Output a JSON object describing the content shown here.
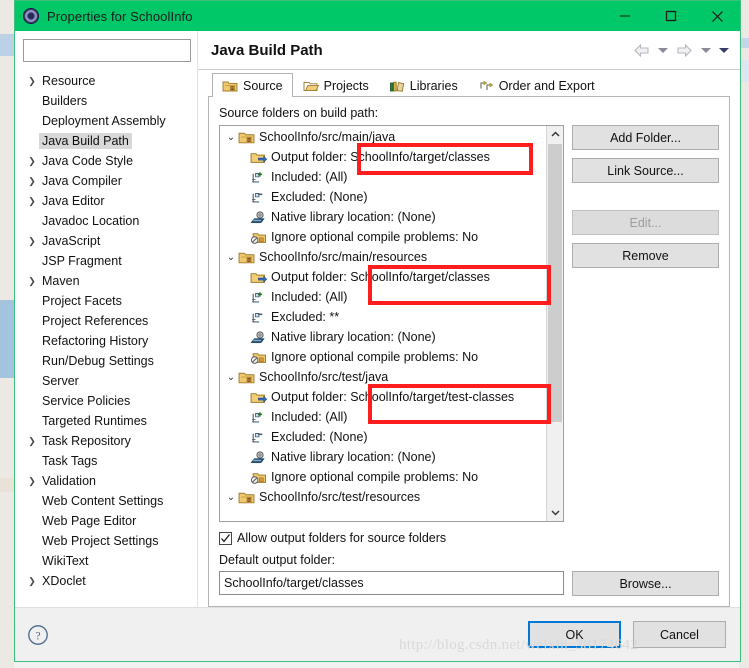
{
  "window": {
    "title": "Properties for SchoolInfo",
    "icon": "eclipse-properties-icon",
    "minimize_label": "—",
    "maximize_label": "□",
    "close_label": "✕",
    "accent_color": "#00c767"
  },
  "sidebar": {
    "filter_value": "",
    "filter_placeholder": "",
    "items": [
      {
        "label": "Resource",
        "expandable": true,
        "selected": false
      },
      {
        "label": "Builders",
        "expandable": false,
        "selected": false
      },
      {
        "label": "Deployment Assembly",
        "expandable": false,
        "selected": false
      },
      {
        "label": "Java Build Path",
        "expandable": false,
        "selected": true
      },
      {
        "label": "Java Code Style",
        "expandable": true,
        "selected": false
      },
      {
        "label": "Java Compiler",
        "expandable": true,
        "selected": false
      },
      {
        "label": "Java Editor",
        "expandable": true,
        "selected": false
      },
      {
        "label": "Javadoc Location",
        "expandable": false,
        "selected": false
      },
      {
        "label": "JavaScript",
        "expandable": true,
        "selected": false
      },
      {
        "label": "JSP Fragment",
        "expandable": false,
        "selected": false
      },
      {
        "label": "Maven",
        "expandable": true,
        "selected": false
      },
      {
        "label": "Project Facets",
        "expandable": false,
        "selected": false
      },
      {
        "label": "Project References",
        "expandable": false,
        "selected": false
      },
      {
        "label": "Refactoring History",
        "expandable": false,
        "selected": false
      },
      {
        "label": "Run/Debug Settings",
        "expandable": false,
        "selected": false
      },
      {
        "label": "Server",
        "expandable": false,
        "selected": false
      },
      {
        "label": "Service Policies",
        "expandable": false,
        "selected": false
      },
      {
        "label": "Targeted Runtimes",
        "expandable": false,
        "selected": false
      },
      {
        "label": "Task Repository",
        "expandable": true,
        "selected": false
      },
      {
        "label": "Task Tags",
        "expandable": false,
        "selected": false
      },
      {
        "label": "Validation",
        "expandable": true,
        "selected": false
      },
      {
        "label": "Web Content Settings",
        "expandable": false,
        "selected": false
      },
      {
        "label": "Web Page Editor",
        "expandable": false,
        "selected": false
      },
      {
        "label": "Web Project Settings",
        "expandable": false,
        "selected": false
      },
      {
        "label": "WikiText",
        "expandable": false,
        "selected": false
      },
      {
        "label": "XDoclet",
        "expandable": true,
        "selected": false
      }
    ]
  },
  "page": {
    "title": "Java Build Path",
    "nav": {
      "back_icon": "arrow-left-icon",
      "back_menu_icon": "chevron-down-icon",
      "forward_icon": "arrow-right-icon",
      "forward_menu_icon": "chevron-down-icon",
      "menu_icon": "chevron-down-filled-icon"
    }
  },
  "tabs": [
    {
      "label": "Source",
      "icon": "source-folder-icon",
      "active": true
    },
    {
      "label": "Projects",
      "icon": "open-folder-icon",
      "active": false
    },
    {
      "label": "Libraries",
      "icon": "books-icon",
      "active": false
    },
    {
      "label": "Order and Export",
      "icon": "order-export-icon",
      "active": false
    }
  ],
  "source_tab": {
    "list_label": "Source folders on build path:",
    "tree": [
      {
        "level": 0,
        "twist": "⌄",
        "icon": "source-folder-icon",
        "label": "SchoolInfo/src/main/java"
      },
      {
        "level": 1,
        "twist": "",
        "icon": "output-folder-icon",
        "label": "Output folder: SchoolInfo/target/classes"
      },
      {
        "level": 1,
        "twist": "",
        "icon": "include-icon",
        "label": "Included: (All)"
      },
      {
        "level": 1,
        "twist": "",
        "icon": "exclude-icon",
        "label": "Excluded: (None)"
      },
      {
        "level": 1,
        "twist": "",
        "icon": "native-library-icon",
        "label": "Native library location: (None)"
      },
      {
        "level": 1,
        "twist": "",
        "icon": "ignore-problems-icon",
        "label": "Ignore optional compile problems: No"
      },
      {
        "level": 0,
        "twist": "⌄",
        "icon": "source-folder-icon",
        "label": "SchoolInfo/src/main/resources"
      },
      {
        "level": 1,
        "twist": "",
        "icon": "output-folder-icon",
        "label": "Output folder: SchoolInfo/target/classes"
      },
      {
        "level": 1,
        "twist": "",
        "icon": "include-icon",
        "label": "Included: (All)"
      },
      {
        "level": 1,
        "twist": "",
        "icon": "exclude-icon",
        "label": "Excluded: **"
      },
      {
        "level": 1,
        "twist": "",
        "icon": "native-library-icon",
        "label": "Native library location: (None)"
      },
      {
        "level": 1,
        "twist": "",
        "icon": "ignore-problems-icon",
        "label": "Ignore optional compile problems: No"
      },
      {
        "level": 0,
        "twist": "⌄",
        "icon": "source-folder-icon",
        "label": "SchoolInfo/src/test/java"
      },
      {
        "level": 1,
        "twist": "",
        "icon": "output-folder-icon",
        "label": "Output folder: SchoolInfo/target/test-classes"
      },
      {
        "level": 1,
        "twist": "",
        "icon": "include-icon",
        "label": "Included: (All)"
      },
      {
        "level": 1,
        "twist": "",
        "icon": "exclude-icon",
        "label": "Excluded: (None)"
      },
      {
        "level": 1,
        "twist": "",
        "icon": "native-library-icon",
        "label": "Native library location: (None)"
      },
      {
        "level": 1,
        "twist": "",
        "icon": "ignore-problems-icon",
        "label": "Ignore optional compile problems: No"
      },
      {
        "level": 0,
        "twist": "⌄",
        "icon": "source-folder-icon",
        "label": "SchoolInfo/src/test/resources"
      }
    ],
    "scrollbar": {
      "up_icon": "chevron-up-icon",
      "down_icon": "chevron-down-icon"
    },
    "buttons": [
      {
        "label": "Add Folder...",
        "disabled": false
      },
      {
        "label": "Link Source...",
        "disabled": false
      },
      {
        "label": "Edit...",
        "disabled": true
      },
      {
        "label": "Remove",
        "disabled": false
      }
    ],
    "allow_output_checkbox": {
      "label": "Allow output folders for source folders",
      "checked": true
    },
    "default_output_label": "Default output folder:",
    "default_output_value": "SchoolInfo/target/classes",
    "browse_label": "Browse..."
  },
  "annotations": {
    "color": "#ff1d1d",
    "boxes": [
      {
        "name": "highlight-output-main-java",
        "text": "SchoolInfo/target/classes"
      },
      {
        "name": "highlight-output-main-resources",
        "text": "choolInfo/target/classes"
      },
      {
        "name": "highlight-output-test-java",
        "text": "choolInfo/target/test-classes"
      }
    ]
  },
  "footer": {
    "help_icon": "help-question-icon",
    "ok_label": "OK",
    "cancel_label": "Cancel",
    "watermark": "http://blog.csdn.net/weixin_38174642"
  }
}
